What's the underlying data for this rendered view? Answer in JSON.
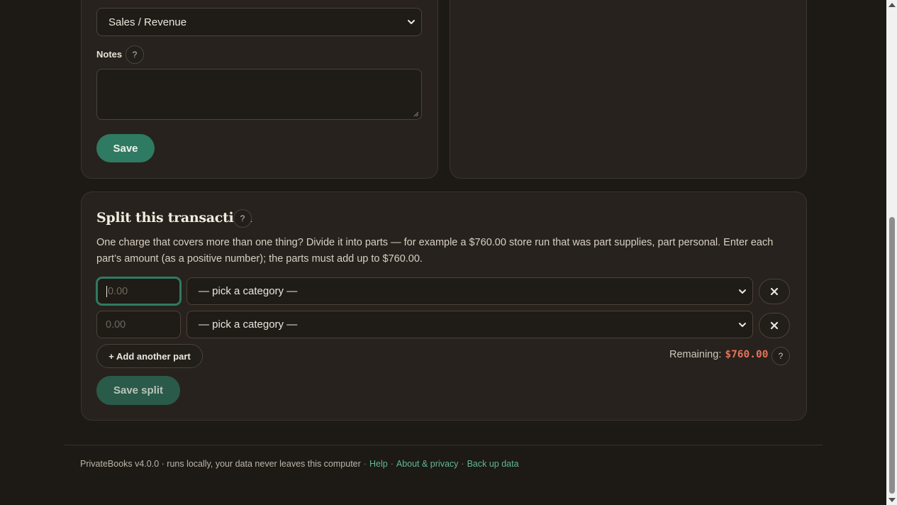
{
  "transaction_form": {
    "category_select": {
      "value": "Sales / Revenue"
    },
    "notes": {
      "label": "Notes",
      "help": "?",
      "value": ""
    },
    "save_label": "Save"
  },
  "split": {
    "title": "Split this transaction",
    "help": "?",
    "description": "One charge that covers more than one thing? Divide it into parts — for example a $760.00 store run that was part supplies, part personal. Enter each part’s amount (as a positive number); the parts must add up to $760.00.",
    "parts": [
      {
        "amount_placeholder": "0.00",
        "category": "— pick a category —"
      },
      {
        "amount_placeholder": "0.00",
        "category": "— pick a category —"
      }
    ],
    "add_part_label": "+ Add another part",
    "remaining_label": "Remaining:",
    "remaining_value": "$760.00",
    "remaining_help": "?",
    "save_split_label": "Save split"
  },
  "footer": {
    "text": "PrivateBooks v4.0.0 · runs locally, your data never leaves this computer",
    "sep": "·",
    "links": [
      "Help",
      "About & privacy",
      "Back up data"
    ]
  }
}
